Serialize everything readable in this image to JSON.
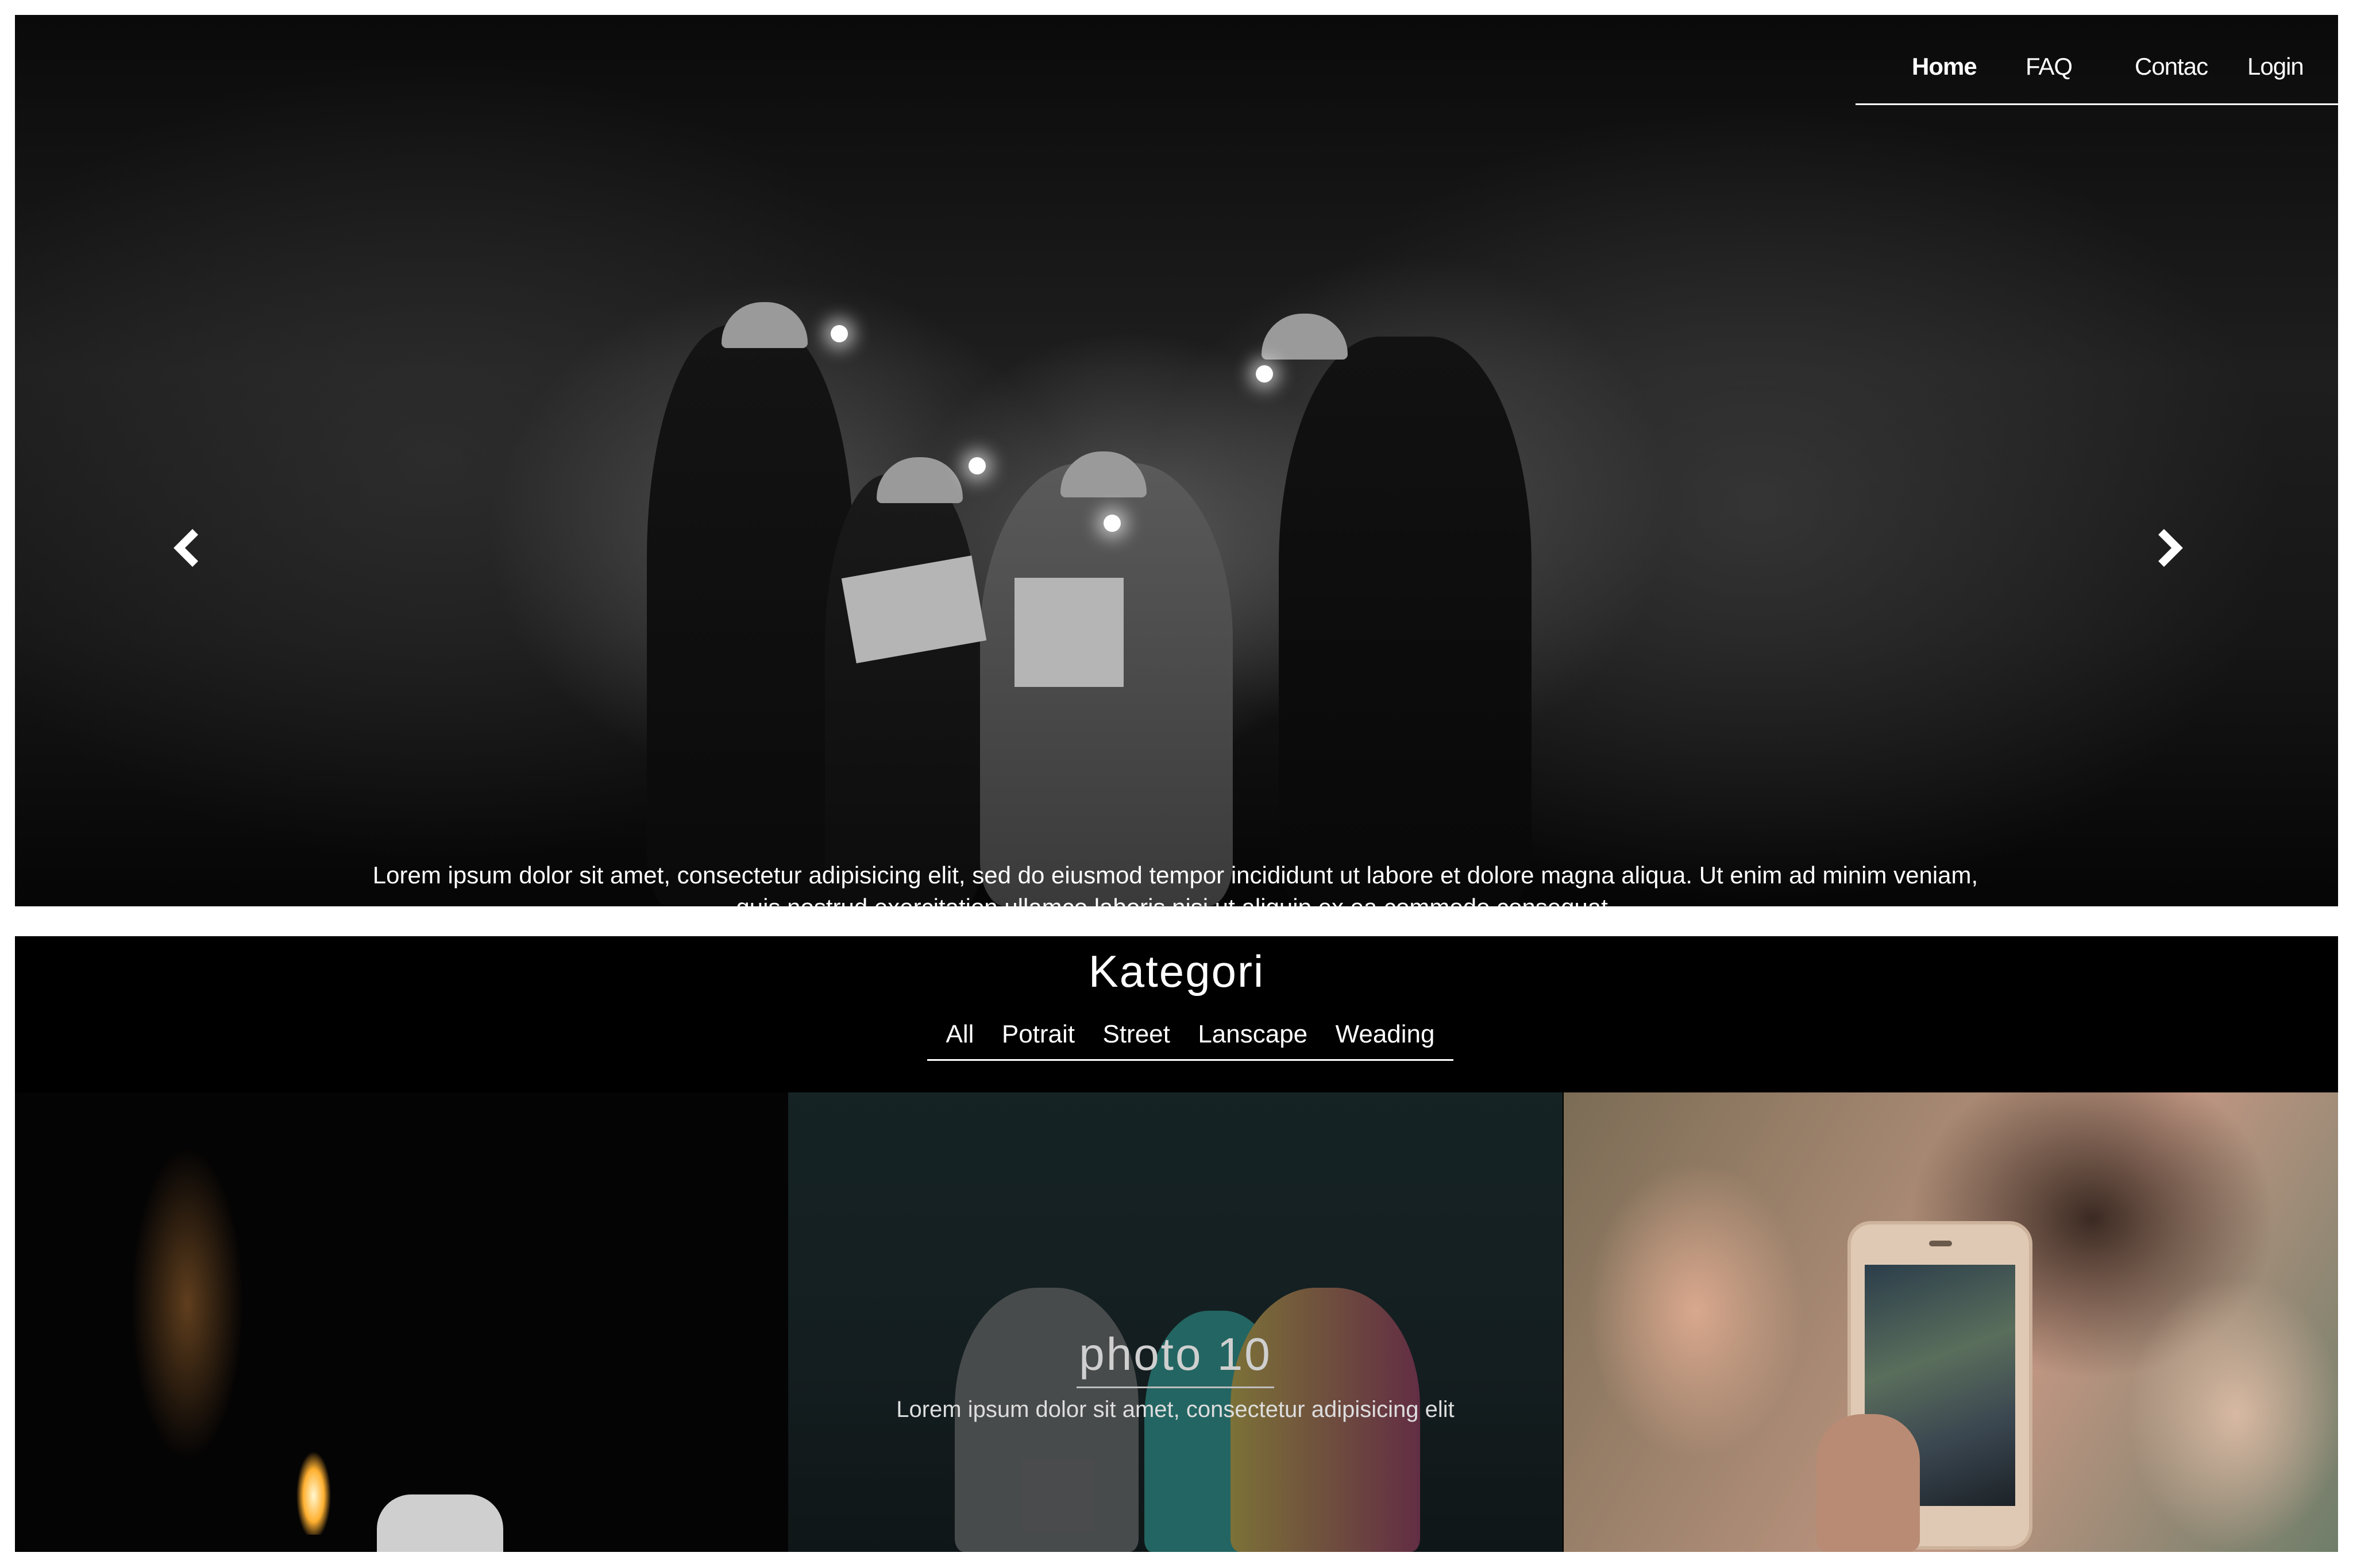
{
  "nav": {
    "items": [
      {
        "label": "Home",
        "active": true
      },
      {
        "label": "FAQ",
        "active": false
      },
      {
        "label": "Contac",
        "active": false
      },
      {
        "label": "Login",
        "active": false
      }
    ]
  },
  "hero": {
    "caption": "Lorem ipsum dolor sit amet, consectetur adipisicing elit, sed do eiusmod tempor incididunt ut labore et dolore magna aliqua. Ut enim ad minim veniam, quis nostrud exercitation ullamco laboris nisi ut aliquip ex ea commodo consequat.",
    "prev_icon": "chevron-left-icon",
    "next_icon": "chevron-right-icon"
  },
  "category": {
    "title": "Kategori",
    "filters": [
      "All",
      "Potrait",
      "Street",
      "Lanscape",
      "Weading"
    ]
  },
  "gallery": {
    "featured": {
      "title": "photo 10",
      "description": "Lorem ipsum dolor sit amet, consectetur adipisicing elit"
    }
  },
  "colors": {
    "background": "#000000",
    "text": "#ffffff",
    "page": "#ffffff"
  }
}
